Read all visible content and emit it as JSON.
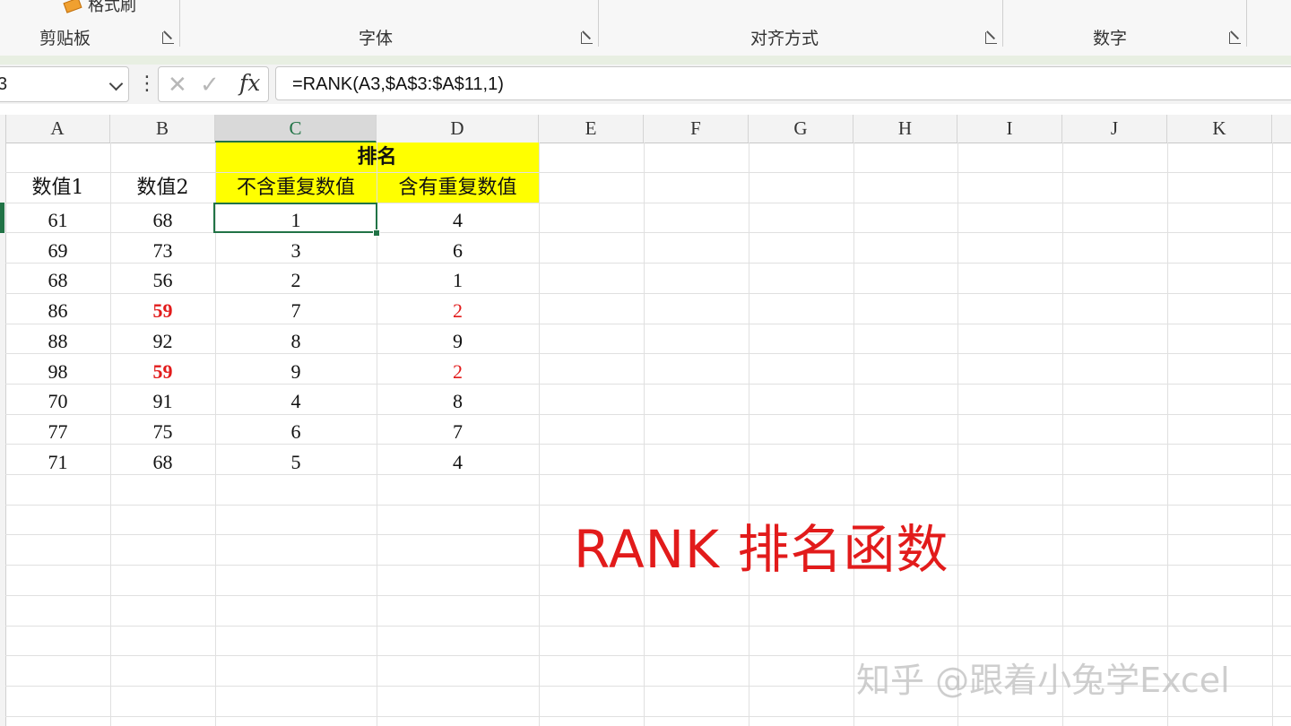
{
  "ribbon": {
    "format_painter": "格式刷",
    "groups": [
      "剪贴板",
      "字体",
      "对齐方式",
      "数字"
    ]
  },
  "formula_bar": {
    "name_box": "3",
    "fx": "fx",
    "formula": "=RANK(A3,$A$3:$A$11,1)"
  },
  "columns": [
    "A",
    "B",
    "C",
    "D",
    "E",
    "F",
    "G",
    "H",
    "I",
    "J",
    "K"
  ],
  "sheet": {
    "header_merged": "排名",
    "headers": {
      "a": "数值1",
      "b": "数值2",
      "c": "不含重复数值",
      "d": "含有重复数值"
    },
    "rows": [
      {
        "a": "61",
        "b": "68",
        "c": "1",
        "d": "4"
      },
      {
        "a": "69",
        "b": "73",
        "c": "3",
        "d": "6"
      },
      {
        "a": "68",
        "b": "56",
        "c": "2",
        "d": "1"
      },
      {
        "a": "86",
        "b": "59",
        "c": "7",
        "d": "2",
        "b_highlight": true,
        "d_highlight": true
      },
      {
        "a": "88",
        "b": "92",
        "c": "8",
        "d": "9"
      },
      {
        "a": "98",
        "b": "59",
        "c": "9",
        "d": "2",
        "b_highlight": true,
        "d_highlight": true
      },
      {
        "a": "70",
        "b": "91",
        "c": "4",
        "d": "8"
      },
      {
        "a": "77",
        "b": "75",
        "c": "6",
        "d": "7"
      },
      {
        "a": "71",
        "b": "68",
        "c": "5",
        "d": "4"
      }
    ]
  },
  "overlay": {
    "title": "RANK  排名函数",
    "watermark": "知乎 @跟着小兔学Excel"
  },
  "colors": {
    "accent_green": "#217346",
    "highlight_yellow": "#ffff00",
    "highlight_red": "#e21b1b"
  }
}
